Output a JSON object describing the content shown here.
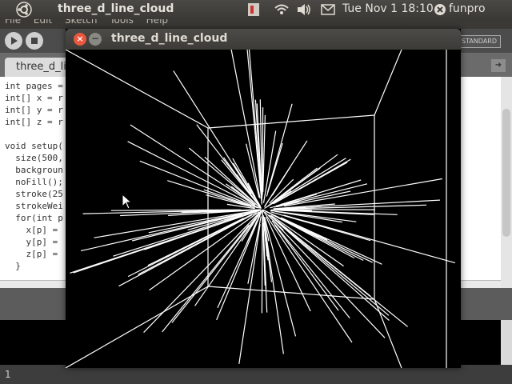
{
  "top_panel": {
    "app_title": "three_d_line_cloud",
    "clock": "Tue Nov 1 18:10",
    "user_name": "funpro"
  },
  "ide": {
    "menu": [
      "File",
      "Edit",
      "Sketch",
      "Tools",
      "Help"
    ],
    "mode_label": "STANDARD",
    "tab_label": "three_d_li",
    "code_lines": [
      "int pages =",
      "int[] x = r",
      "int[] y = r",
      "int[] z = r",
      "",
      "void setup(",
      "  size(500,",
      "  backgroun",
      "  noFill();",
      "  stroke(25",
      "  strokeWei",
      "  for(int p",
      "    x[p] =",
      "    y[p] =",
      "    z[p] =",
      "  }"
    ],
    "line_number": "1"
  },
  "sketch_window": {
    "title": "three_d_line_cloud"
  }
}
